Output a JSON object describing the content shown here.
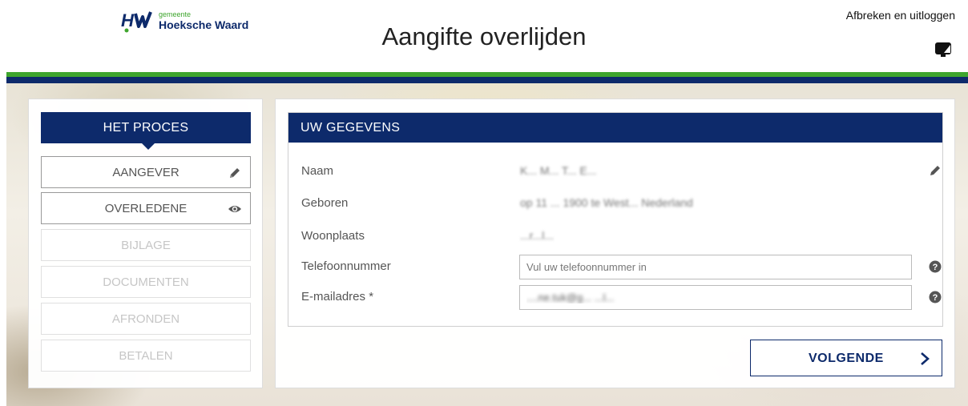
{
  "header": {
    "logo_small": "gemeente",
    "logo_name": "Hoeksche Waard",
    "logo_mark": "HW",
    "title": "Aangifte overlijden",
    "logout_label": "Afbreken en uitloggen",
    "screen_icon": "screen-toggle-icon"
  },
  "colors": {
    "navy": "#0d2a6b",
    "green": "#3ea52d"
  },
  "process": {
    "title": "HET PROCES",
    "steps": [
      {
        "label": "AANGEVER",
        "state": "active",
        "icon": "pencil-icon"
      },
      {
        "label": "OVERLEDENE",
        "state": "active",
        "icon": "eye-icon"
      },
      {
        "label": "BIJLAGE",
        "state": "disabled"
      },
      {
        "label": "DOCUMENTEN",
        "state": "disabled"
      },
      {
        "label": "AFRONDEN",
        "state": "disabled"
      },
      {
        "label": "BETALEN",
        "state": "disabled"
      }
    ]
  },
  "details": {
    "title": "UW GEGEVENS",
    "rows": [
      {
        "label": "Naam",
        "value": "K... M... T... E..."
      },
      {
        "label": "Geboren",
        "value": "op 11 ... 1900 te West... Nederland"
      },
      {
        "label": "Woonplaats",
        "value": "...r...l..."
      },
      {
        "label": "Telefoonnummer",
        "placeholder": "Vul uw telefoonnummer in",
        "value": ""
      },
      {
        "label": "E-mailadres *",
        "value": "....ne.tuk@g... ...l..."
      }
    ]
  },
  "actions": {
    "next_label": "VOLGENDE"
  }
}
